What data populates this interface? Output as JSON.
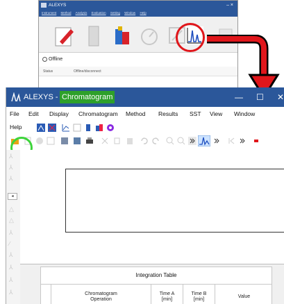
{
  "top_window": {
    "title": "ALEXYS",
    "close": "–   ×",
    "menu": [
      "Instrument",
      "Method",
      "Analysis",
      "Evaluation",
      "Setting",
      "Window",
      "Help"
    ],
    "status": "Offline",
    "grid_label": "Status",
    "grid_value": "Offline/disconnect"
  },
  "main_window": {
    "app_name": "ALEXYS -",
    "window_name": "Chromatogram",
    "minimize": "—",
    "maximize": "☐",
    "close": "✕",
    "menu": {
      "file": "File",
      "edit": "Edit",
      "display": "Display",
      "chromatogram": "Chromatogram",
      "method": "Method",
      "results": "Results",
      "sst": "SST",
      "view": "View",
      "window": "Window",
      "help": "Help"
    },
    "toolbar_icons": [
      "open-folder-icon",
      "save-icon",
      "print-icon",
      "zoom-in-icon",
      "zoom-out-icon",
      "undo-icon",
      "redo-icon",
      "chromatogram-icon"
    ],
    "integration_table": {
      "title": "Integration Table",
      "columns": [
        {
          "line1": "Chromatogram",
          "line2": "Operation"
        },
        {
          "line1": "Time A",
          "line2": "[min]"
        },
        {
          "line1": "Time B",
          "line2": "[min]"
        },
        {
          "line1": "Value",
          "line2": ""
        }
      ]
    }
  },
  "colors": {
    "title_bar": "#2b579a",
    "highlight_window": "#2ea02a",
    "red_marker": "#e0161b",
    "green_marker": "#3dd43a"
  }
}
